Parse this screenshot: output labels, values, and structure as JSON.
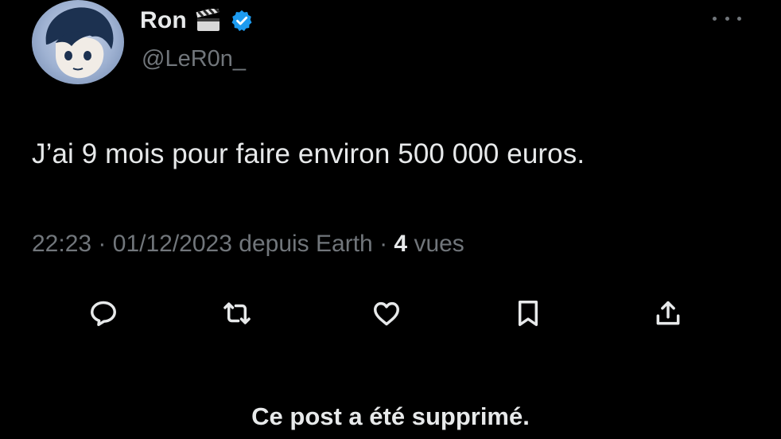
{
  "user": {
    "display_name": "Ron",
    "handle": "@LeR0n_",
    "name_emoji_icon": "clapper-board-icon",
    "verified_icon": "verified-badge-icon",
    "verified_color": "#1d9bf0"
  },
  "tweet": {
    "text": "J’ai 9 mois pour faire environ 500 000 euros.",
    "time": "22:23",
    "separator": "·",
    "date": "01/12/2023",
    "source": "depuis Earth",
    "views_count": "4",
    "views_label": "vues"
  },
  "actions": [
    {
      "name": "reply",
      "icon": "reply-icon"
    },
    {
      "name": "repost",
      "icon": "repost-icon"
    },
    {
      "name": "like",
      "icon": "heart-icon"
    },
    {
      "name": "bookmark",
      "icon": "bookmark-icon"
    },
    {
      "name": "share",
      "icon": "share-icon"
    }
  ],
  "notice": "Ce post a été supprimé.",
  "colors": {
    "background": "#000000",
    "primary_text": "#e7e9ea",
    "secondary_text": "#71767b"
  }
}
